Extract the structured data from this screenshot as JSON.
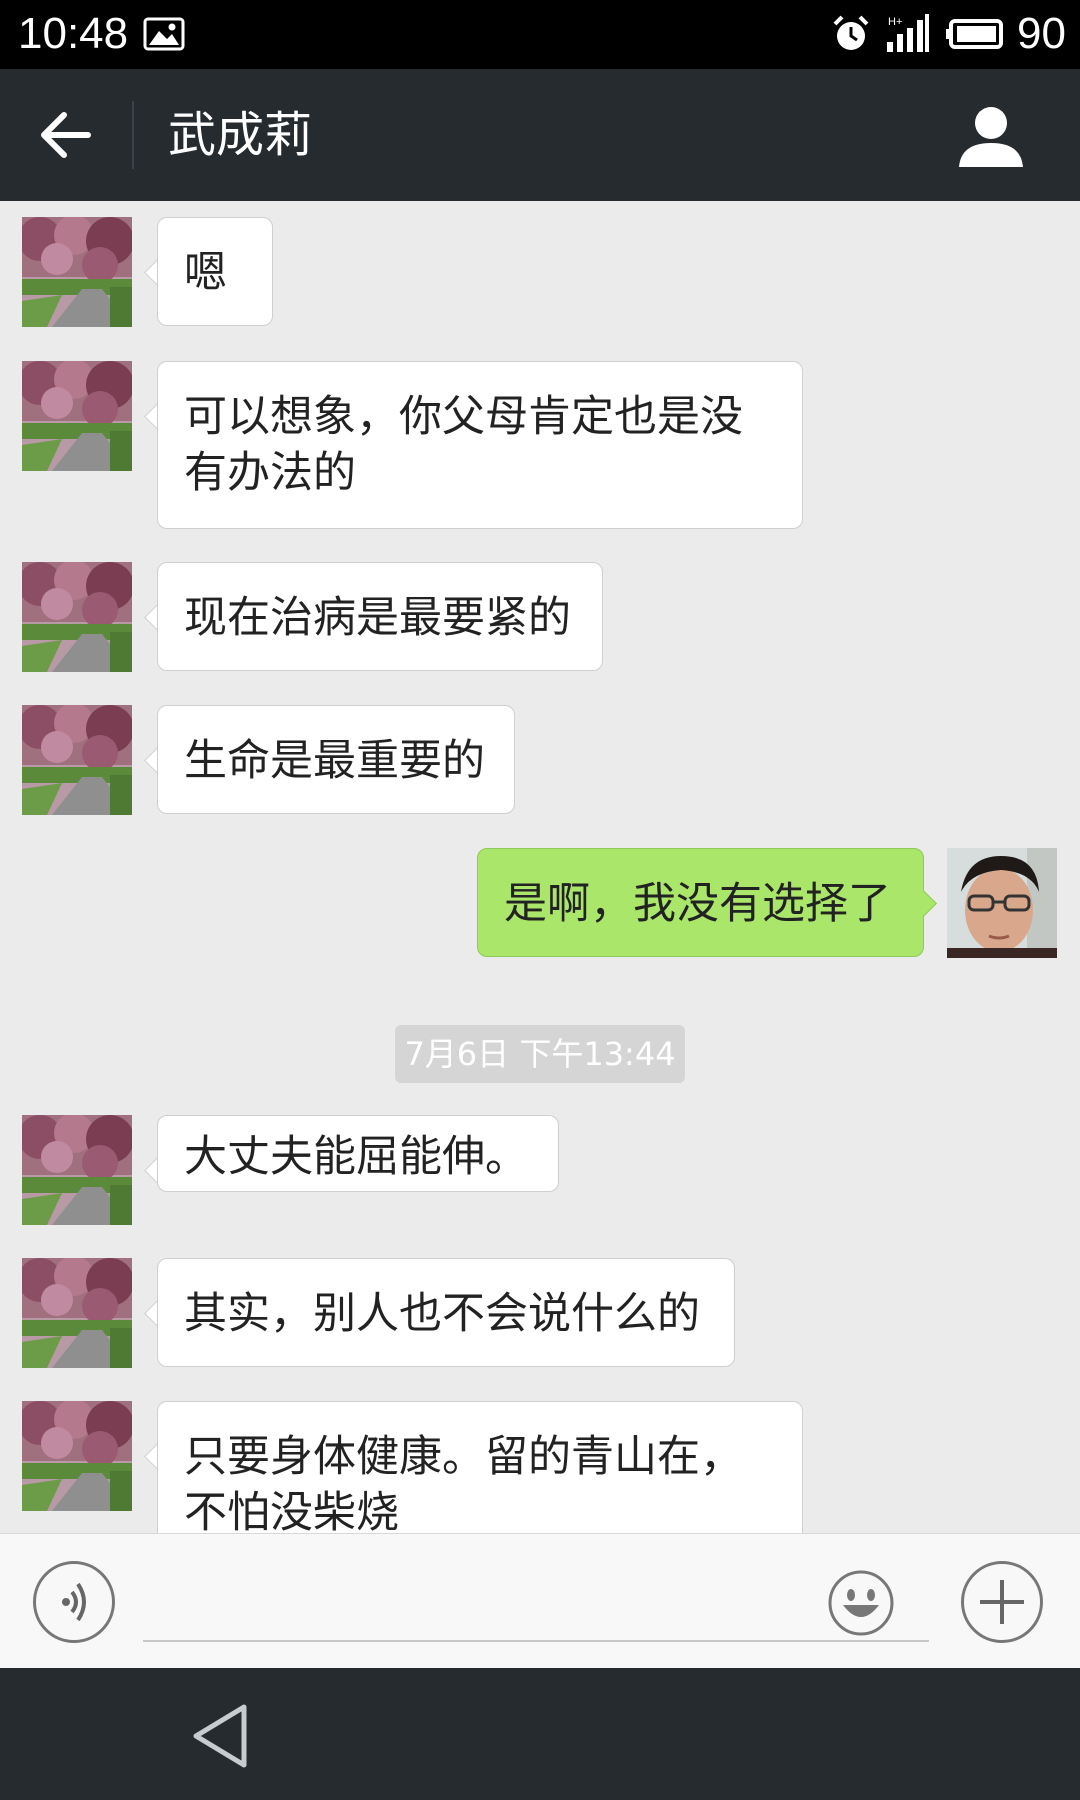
{
  "status_bar": {
    "time": "10:48",
    "battery": "90",
    "network": "H+"
  },
  "header": {
    "title": "武成莉"
  },
  "messages": [
    {
      "side": "in",
      "text": "嗯"
    },
    {
      "side": "in",
      "text": "可以想象，你父母肯定也是没有办法的"
    },
    {
      "side": "in",
      "text": "现在治病是最要紧的"
    },
    {
      "side": "in",
      "text": "生命是最重要的"
    },
    {
      "side": "out",
      "text": "是啊，我没有选择了"
    },
    {
      "side": "in",
      "text": "大丈夫能屈能伸。"
    },
    {
      "side": "in",
      "text": "其实，别人也不会说什么的"
    },
    {
      "side": "in",
      "text": "只要身体健康。留的青山在，不怕没柴烧"
    }
  ],
  "timestamp": "7月6日 下午13:44",
  "input": {
    "value": "",
    "placeholder": ""
  },
  "icons": {
    "back": "arrow-left-icon",
    "contact": "person-icon",
    "voice": "voice-icon",
    "emoji": "smiley-icon",
    "more": "plus-icon",
    "system_back": "triangle-back-icon"
  },
  "colors": {
    "header_bg": "#262b2f",
    "outgoing_bubble": "#a9e66a",
    "incoming_bubble": "#ffffff",
    "chat_bg": "#ebebeb"
  }
}
